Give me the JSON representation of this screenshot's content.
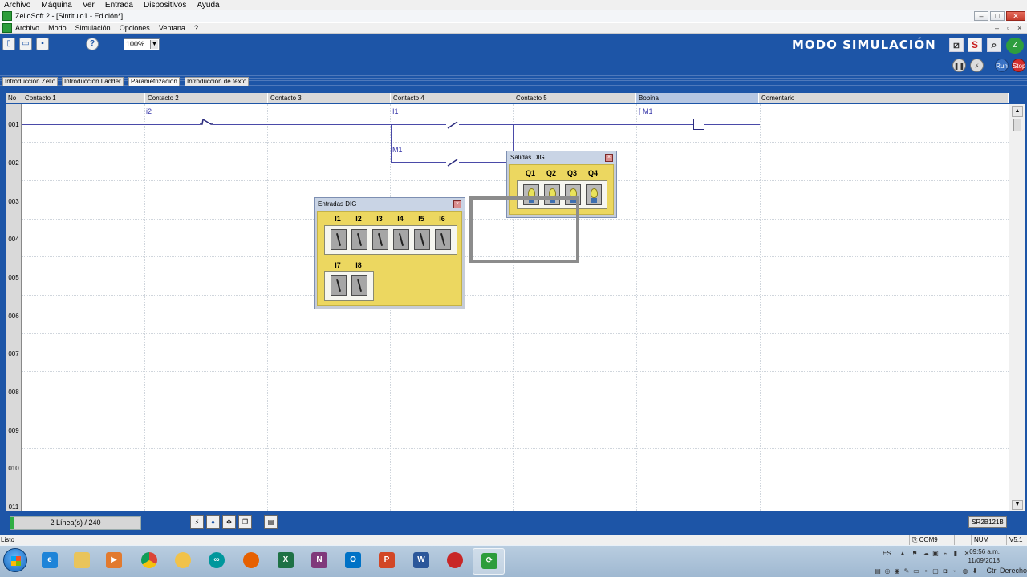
{
  "outer_menu": [
    "Archivo",
    "Máquina",
    "Ver",
    "Entrada",
    "Dispositivos",
    "Ayuda"
  ],
  "window": {
    "title": "ZelioSoft 2 - [Sintitulo1 - Edición*]"
  },
  "inner_menu": [
    "Archivo",
    "Modo",
    "Simulación",
    "Opciones",
    "Ventana",
    "?"
  ],
  "toolbar": {
    "zoom": "100%",
    "help": "?",
    "mode_title": "MODO SIMULACIÓN",
    "s_button": "S",
    "run_label": "Run",
    "stop_label": "Stop"
  },
  "tabs": [
    "Introducción Zelio",
    "Introducción Ladder",
    "Parametrización",
    "Introducción de texto"
  ],
  "ladder": {
    "columns": [
      "No",
      "Contacto 1",
      "Contacto 2",
      "Contacto 3",
      "Contacto 4",
      "Contacto 5",
      "Bobina",
      "Comentario"
    ],
    "rows": [
      "001",
      "002",
      "003",
      "004",
      "005",
      "006",
      "007",
      "008",
      "009",
      "010",
      "011"
    ],
    "labels": {
      "i2": "i2",
      "i1": "I1",
      "m1_contact": "M1",
      "m1_coil": "[ M1"
    }
  },
  "inputs_window": {
    "title": "Entradas DIG",
    "row1": [
      "I1",
      "I2",
      "I3",
      "I4",
      "I5",
      "I6"
    ],
    "row2": [
      "I7",
      "I8"
    ]
  },
  "outputs_window": {
    "title": "Salidas DIG",
    "labels": [
      "Q1",
      "Q2",
      "Q3",
      "Q4"
    ]
  },
  "status": {
    "line_count": "2 Línea(s) / 240",
    "model": "SR2B121B"
  },
  "bottombar": {
    "ready": "Listo",
    "port": "COM9",
    "num": "NUM",
    "version": "V5.1"
  },
  "taskbar": {
    "lang": "ES",
    "time": "09:56 a.m.",
    "date": "11/09/2018",
    "host_key": "Ctrl Derecho"
  }
}
